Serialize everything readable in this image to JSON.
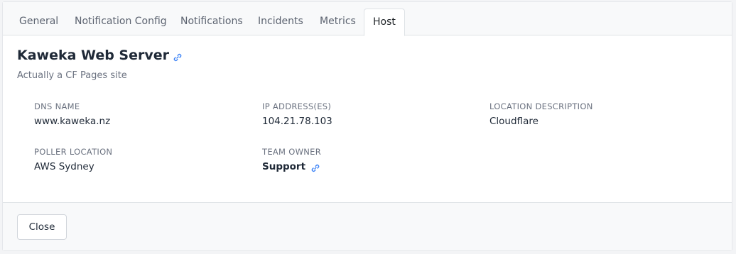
{
  "tabs": [
    {
      "label": "General"
    },
    {
      "label": "Notification Config"
    },
    {
      "label": "Notifications"
    },
    {
      "label": "Incidents"
    },
    {
      "label": "Metrics"
    },
    {
      "label": "Host",
      "active": true
    }
  ],
  "host": {
    "name": "Kaweka Web Server",
    "description": "Actually a CF Pages site",
    "link_icon": "link-icon"
  },
  "fields": {
    "dns_name": {
      "label": "DNS NAME",
      "value": "www.kaweka.nz"
    },
    "ip_addresses": {
      "label": "IP ADDRESS(ES)",
      "value": "104.21.78.103"
    },
    "location_description": {
      "label": "LOCATION DESCRIPTION",
      "value": "Cloudflare"
    },
    "poller_location": {
      "label": "POLLER LOCATION",
      "value": "AWS Sydney"
    },
    "team_owner": {
      "label": "TEAM OWNER",
      "value": "Support"
    }
  },
  "footer": {
    "close_label": "Close"
  },
  "colors": {
    "link_icon": "#3b82f6",
    "active_tab_text": "#212529",
    "tab_text": "#5c6370"
  }
}
